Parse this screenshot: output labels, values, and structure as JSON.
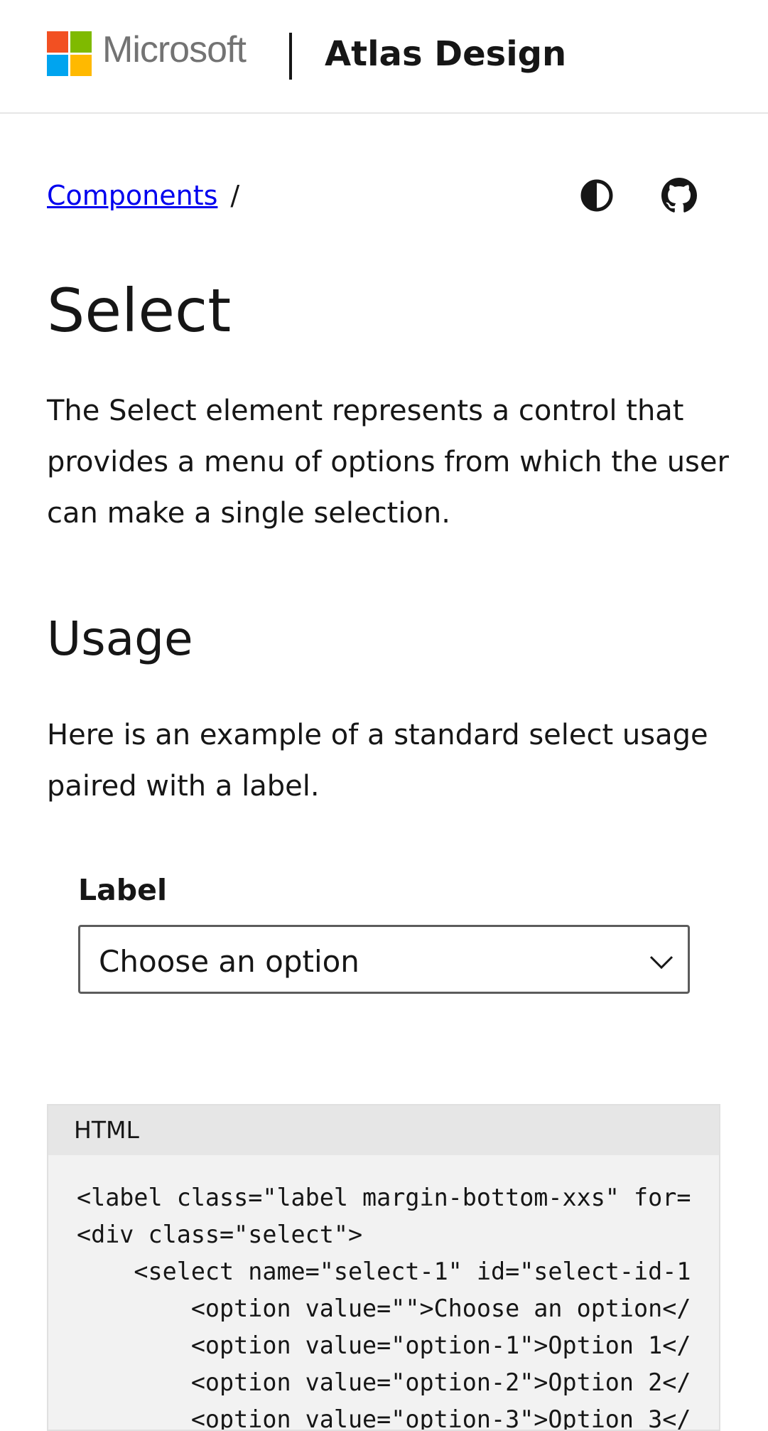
{
  "header": {
    "brand": "Microsoft",
    "site_title": "Atlas Design",
    "logo_colors": [
      "#f25022",
      "#7fba00",
      "#00a4ef",
      "#ffb900"
    ]
  },
  "breadcrumb": {
    "link": "Components",
    "separator": "/"
  },
  "toolbar": {
    "icons": [
      "theme-toggle-icon",
      "github-icon"
    ]
  },
  "page": {
    "title": "Select",
    "intro": "The Select element represents a control that provides a menu of options from which the user can make a single selection."
  },
  "usage": {
    "heading": "Usage",
    "text": "Here is an example of a standard select usage paired with a label.",
    "demo": {
      "label": "Label",
      "selected": "Choose an option"
    }
  },
  "code": {
    "tab": "HTML",
    "lines": [
      "<label class=\"label margin-bottom-xxs\" for=",
      "<div class=\"select\">",
      "    <select name=\"select-1\" id=\"select-id-1",
      "        <option value=\"\">Choose an option</",
      "        <option value=\"option-1\">Option 1</",
      "        <option value=\"option-2\">Option 2</",
      "        <option value=\"option-3\">Option 3</"
    ]
  }
}
